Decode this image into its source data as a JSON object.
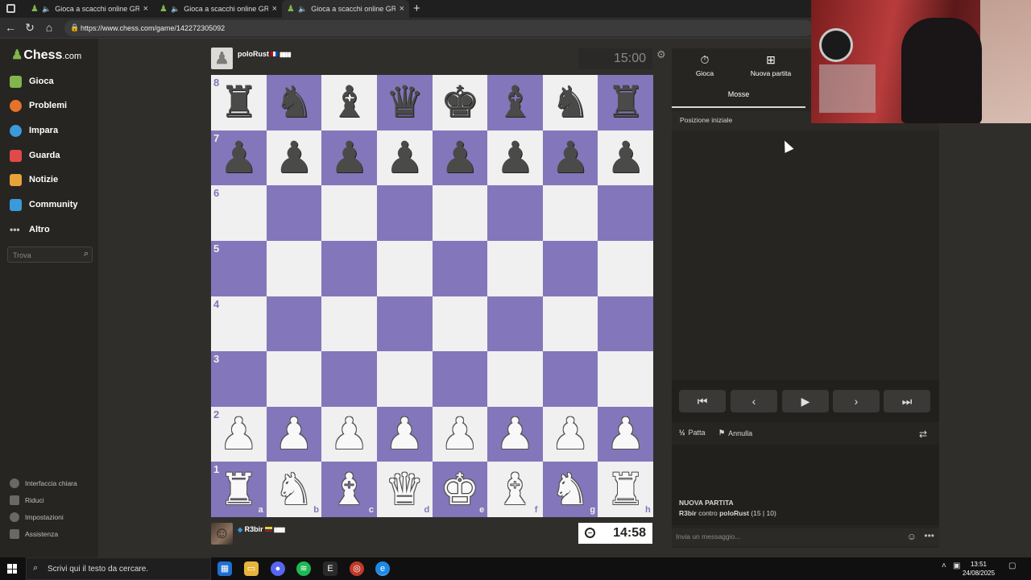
{
  "browser": {
    "tabs": [
      {
        "title": "Gioca a scacchi online GRATIS",
        "audio": false,
        "active": false
      },
      {
        "title": "Gioca a scacchi online GRATIS",
        "audio": true,
        "active": false
      },
      {
        "title": "Gioca a scacchi online GRATIS",
        "audio": false,
        "active": true
      }
    ],
    "url": "https://www.chess.com/game/142272305092"
  },
  "sidebar": {
    "logo": "Chess",
    "logo_suffix": ".com",
    "items": [
      {
        "label": "Gioca",
        "color": "#81b64c"
      },
      {
        "label": "Problemi",
        "color": "#e6732a"
      },
      {
        "label": "Impara",
        "color": "#3b9ad9"
      },
      {
        "label": "Guarda",
        "color": "#e04a4a"
      },
      {
        "label": "Notizie",
        "color": "#e8a33a"
      },
      {
        "label": "Community",
        "color": "#3b9ad9"
      },
      {
        "label": "Altro",
        "color": "#c0bfbd"
      }
    ],
    "search_placeholder": "Trova",
    "footer": [
      {
        "label": "Interfaccia chiara"
      },
      {
        "label": "Riduci"
      },
      {
        "label": "Impostazioni"
      },
      {
        "label": "Assistenza"
      }
    ]
  },
  "game": {
    "top_player": {
      "name": "poloRust",
      "clock": "15:00"
    },
    "bottom_player": {
      "name": "R3bir",
      "clock": "14:58"
    },
    "ranks": [
      "8",
      "7",
      "6",
      "5",
      "4",
      "3",
      "2",
      "1"
    ],
    "files": [
      "a",
      "b",
      "c",
      "d",
      "e",
      "f",
      "g",
      "h"
    ],
    "board": [
      [
        "bR",
        "bN",
        "bB",
        "bQ",
        "bK",
        "bB",
        "bN",
        "bR"
      ],
      [
        "bP",
        "bP",
        "bP",
        "bP",
        "bP",
        "bP",
        "bP",
        "bP"
      ],
      [
        "",
        "",
        "",
        "",
        "",
        "",
        "",
        ""
      ],
      [
        "",
        "",
        "",
        "",
        "",
        "",
        "",
        ""
      ],
      [
        "",
        "",
        "",
        "",
        "",
        "",
        "",
        ""
      ],
      [
        "",
        "",
        "",
        "",
        "",
        "",
        "",
        ""
      ],
      [
        "wP",
        "wP",
        "wP",
        "wP",
        "wP",
        "wP",
        "wP",
        "wP"
      ],
      [
        "wR",
        "wN",
        "wB",
        "wQ",
        "wK",
        "wB",
        "wN",
        "wR"
      ]
    ],
    "colors": {
      "light": "#f0f0f0",
      "dark": "#8476ba"
    }
  },
  "panel": {
    "tabs": [
      {
        "label": "Gioca",
        "icon": "stopwatch-icon"
      },
      {
        "label": "Nuova partita",
        "icon": "plus-square-icon"
      }
    ],
    "subtab": "Mosse",
    "moves_header": "Posizione iniziale",
    "controls": [
      "first-move",
      "previous-move",
      "play",
      "next-move",
      "last-move"
    ],
    "draw_label": "Patta",
    "abort_label": "Annulla",
    "chat": {
      "title": "NUOVA PARTITA",
      "white": "R3bir",
      "vs": " contro ",
      "black": "poloRust",
      "time_control": " (15 | 10)",
      "placeholder": "Invia un messaggio..."
    }
  },
  "taskbar": {
    "search_placeholder": "Scrivi qui il testo da cercare.",
    "time": "13:51",
    "date": "24/08/2025"
  }
}
